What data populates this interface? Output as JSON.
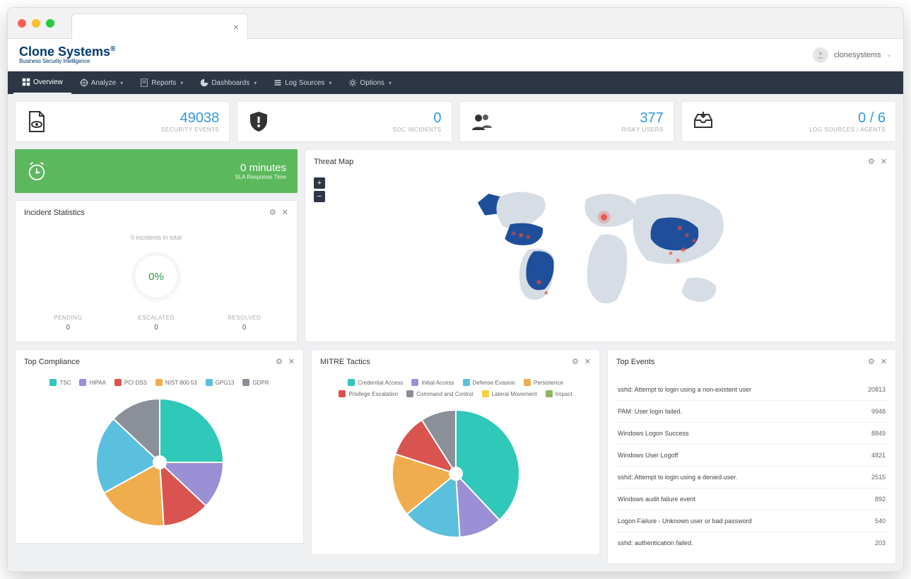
{
  "logo": {
    "main": "Clone Systems",
    "sub": "Business Security Intelligence"
  },
  "user": {
    "name": "clonesystems"
  },
  "nav": {
    "overview": "Overview",
    "analyze": "Analyze",
    "reports": "Reports",
    "dashboards": "Dashboards",
    "logsources": "Log Sources",
    "options": "Options"
  },
  "stats": {
    "security_events": {
      "value": "49038",
      "label": "SECURITY EVENTS"
    },
    "soc_incidents": {
      "value": "0",
      "label": "SOC INCIDENTS"
    },
    "risky_users": {
      "value": "377",
      "label": "RISKY USERS"
    },
    "log_sources": {
      "value": "0 / 6",
      "label": "LOG SOURCES / AGENTS"
    }
  },
  "sla": {
    "value": "0 minutes",
    "label": "SLA Response Time"
  },
  "incident_stats": {
    "title": "Incident Statistics",
    "subtitle": "0 incidents in total",
    "gauge": "0%",
    "cols": {
      "pending": {
        "label": "PENDING",
        "value": "0"
      },
      "escalated": {
        "label": "ESCALATED",
        "value": "0"
      },
      "resolved": {
        "label": "RESOLVED",
        "value": "0"
      }
    }
  },
  "threat_map": {
    "title": "Threat Map"
  },
  "compliance": {
    "title": "Top Compliance",
    "legend": [
      {
        "name": "TSC",
        "color": "#2fc8b9"
      },
      {
        "name": "HIPAA",
        "color": "#9b8fd6"
      },
      {
        "name": "PCI DSS",
        "color": "#d9534f"
      },
      {
        "name": "NIST 800 53",
        "color": "#f0ad4e"
      },
      {
        "name": "GPG13",
        "color": "#5bc0de"
      },
      {
        "name": "GDPR",
        "color": "#8a8f98"
      }
    ]
  },
  "mitre": {
    "title": "MITRE Tactics",
    "legend": [
      {
        "name": "Credential Access",
        "color": "#2fc8b9"
      },
      {
        "name": "Initial Access",
        "color": "#9b8fd6"
      },
      {
        "name": "Defense Evasion",
        "color": "#5bc0de"
      },
      {
        "name": "Persistence",
        "color": "#f0ad4e"
      },
      {
        "name": "Privilege Escalation",
        "color": "#d9534f"
      },
      {
        "name": "Command and Control",
        "color": "#8a8f98"
      },
      {
        "name": "Lateral Movement",
        "color": "#f4d03f"
      },
      {
        "name": "Impact",
        "color": "#8bb85c"
      }
    ]
  },
  "top_events": {
    "title": "Top Events",
    "rows": [
      {
        "name": "sshd: Attempt to login using a non-existent user",
        "count": "20813"
      },
      {
        "name": "PAM: User login failed.",
        "count": "9948"
      },
      {
        "name": "Windows Logon Success",
        "count": "8849"
      },
      {
        "name": "Windows User Logoff",
        "count": "4821"
      },
      {
        "name": "sshd: Attempt to login using a denied user.",
        "count": "2515"
      },
      {
        "name": "Windows audit failure event",
        "count": "892"
      },
      {
        "name": "Logon Failure - Unknown user or bad password",
        "count": "540"
      },
      {
        "name": "sshd: authentication failed.",
        "count": "203"
      }
    ]
  },
  "chart_data": [
    {
      "type": "pie",
      "title": "Top Compliance",
      "series": [
        {
          "name": "TSC",
          "value": 25,
          "color": "#2fc8b9"
        },
        {
          "name": "HIPAA",
          "value": 12,
          "color": "#9b8fd6"
        },
        {
          "name": "PCI DSS",
          "value": 12,
          "color": "#d9534f"
        },
        {
          "name": "NIST 800 53",
          "value": 18,
          "color": "#f0ad4e"
        },
        {
          "name": "GPG13",
          "value": 20,
          "color": "#5bc0de"
        },
        {
          "name": "GDPR",
          "value": 13,
          "color": "#8a8f98"
        }
      ]
    },
    {
      "type": "pie",
      "title": "MITRE Tactics",
      "series": [
        {
          "name": "Credential Access",
          "value": 38,
          "color": "#2fc8b9"
        },
        {
          "name": "Initial Access",
          "value": 11,
          "color": "#9b8fd6"
        },
        {
          "name": "Defense Evasion",
          "value": 15,
          "color": "#5bc0de"
        },
        {
          "name": "Persistence",
          "value": 16,
          "color": "#f0ad4e"
        },
        {
          "name": "Privilege Escalation",
          "value": 11,
          "color": "#d9534f"
        },
        {
          "name": "Command and Control",
          "value": 9,
          "color": "#8a8f98"
        }
      ]
    }
  ]
}
